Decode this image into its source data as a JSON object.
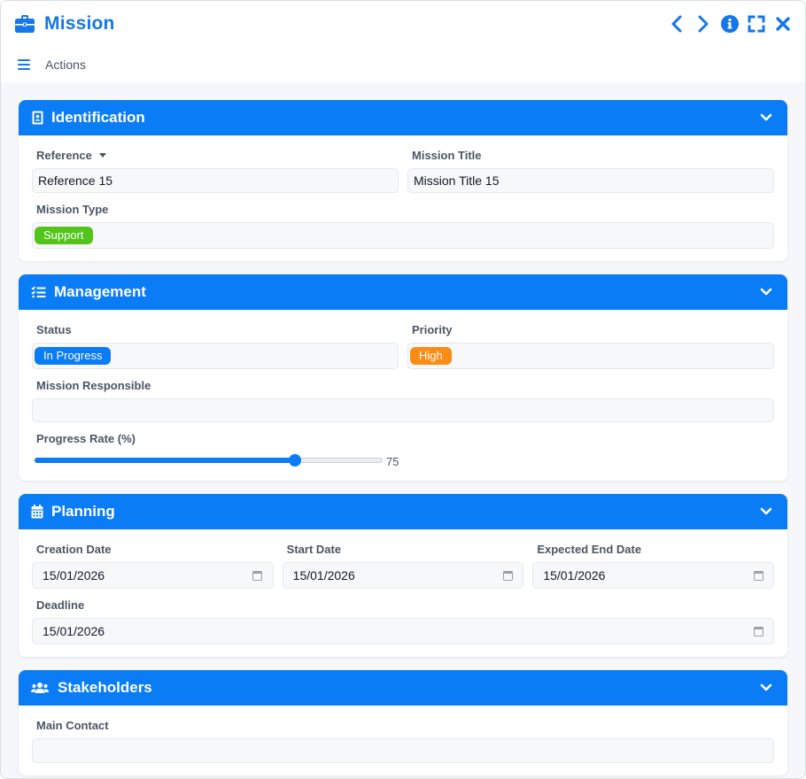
{
  "window": {
    "title": "Mission",
    "icon": "briefcase-icon",
    "accent": "#1677e8"
  },
  "menu": {
    "actions_label": "Actions"
  },
  "sections": {
    "identification": {
      "title": "Identification",
      "reference": {
        "label": "Reference",
        "value": "Reference 15"
      },
      "mission_title": {
        "label": "Mission Title",
        "value": "Mission Title 15"
      },
      "mission_type": {
        "label": "Mission Type",
        "value": "Support",
        "color": "#52c41a"
      }
    },
    "management": {
      "title": "Management",
      "status": {
        "label": "Status",
        "value": "In Progress",
        "color": "#0a7cf5"
      },
      "priority": {
        "label": "Priority",
        "value": "High",
        "color": "#fa8c16"
      },
      "responsible": {
        "label": "Mission Responsible",
        "value": ""
      },
      "progress": {
        "label": "Progress Rate (%)",
        "value": 75,
        "display": "75"
      }
    },
    "planning": {
      "title": "Planning",
      "creation_date": {
        "label": "Creation Date",
        "value": "15/01/2026"
      },
      "start_date": {
        "label": "Start Date",
        "value": "15/01/2026"
      },
      "expected_end_date": {
        "label": "Expected End Date",
        "value": "15/01/2026"
      },
      "deadline": {
        "label": "Deadline",
        "value": "15/01/2026"
      }
    },
    "stakeholders": {
      "title": "Stakeholders",
      "main_contact": {
        "label": "Main Contact"
      }
    }
  }
}
